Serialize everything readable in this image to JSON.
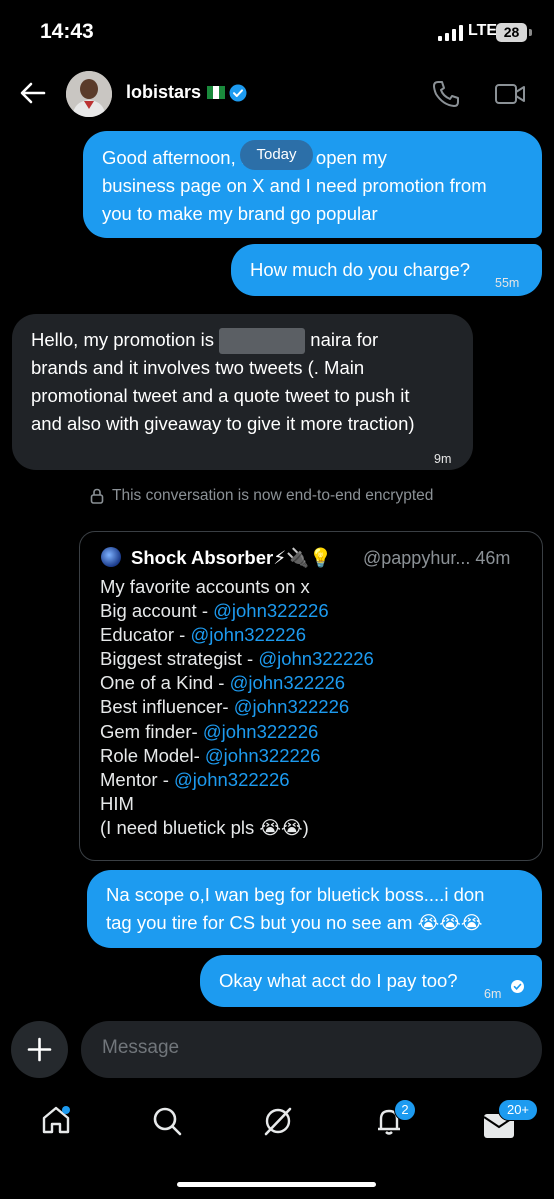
{
  "status_bar": {
    "time": "14:43",
    "network": "LTE",
    "battery": "28"
  },
  "header": {
    "username": "lobistars",
    "verified": true,
    "flag": "nigeria-flag"
  },
  "messages": {
    "date_pill": "Today",
    "m1_line1": "Good afternoon, I want to open my",
    "m1_line2": "business page on X and I need promotion from",
    "m1_line3": "you to make my brand go popular",
    "m2_text": "How much do you charge?",
    "m2_time": "55m",
    "m3_line1_a": "Hello, my promotion is",
    "m3_line1_b": "naira for",
    "m3_line2": "brands and it involves two tweets (. Main",
    "m3_line3": "promotional tweet and a quote tweet to push it",
    "m3_line4": "and also with giveaway to give it more traction)",
    "m3_time": "9m",
    "encryption_note": "This conversation is now end-to-end encrypted",
    "m5_line1": "Na scope o,I wan beg for bluetick boss....i don",
    "m5_line2": "tag you tire for CS but you no see am 😭😭😭",
    "m6_text": "Okay what acct do I pay too?",
    "m6_time": "6m"
  },
  "quote": {
    "name": "Shock Absorber⚡🔌💡",
    "handle": "@pappyhur...",
    "time": "46m",
    "intro": "My favorite accounts on x",
    "rows": [
      {
        "label": "Big account - ",
        "mention": "@john322226"
      },
      {
        "label": "Educator - ",
        "mention": "@john322226"
      },
      {
        "label": "Biggest strategist - ",
        "mention": "@john322226"
      },
      {
        "label": "One of a Kind - ",
        "mention": "@john322226"
      },
      {
        "label": "Best influencer- ",
        "mention": "@john322226"
      },
      {
        "label": "Gem finder- ",
        "mention": "@john322226"
      },
      {
        "label": "Role Model- ",
        "mention": "@john322226"
      },
      {
        "label": "Mentor - ",
        "mention": "@john322226"
      }
    ],
    "outro1": "HIM",
    "outro2": "(I need bluetick pls 😭😭)"
  },
  "composer": {
    "placeholder": "Message"
  },
  "nav": {
    "notifications_badge": "2",
    "messages_badge": "20+"
  },
  "colors": {
    "accent": "#1d9bf0",
    "background": "#000000",
    "incoming_bubble": "#202327"
  }
}
